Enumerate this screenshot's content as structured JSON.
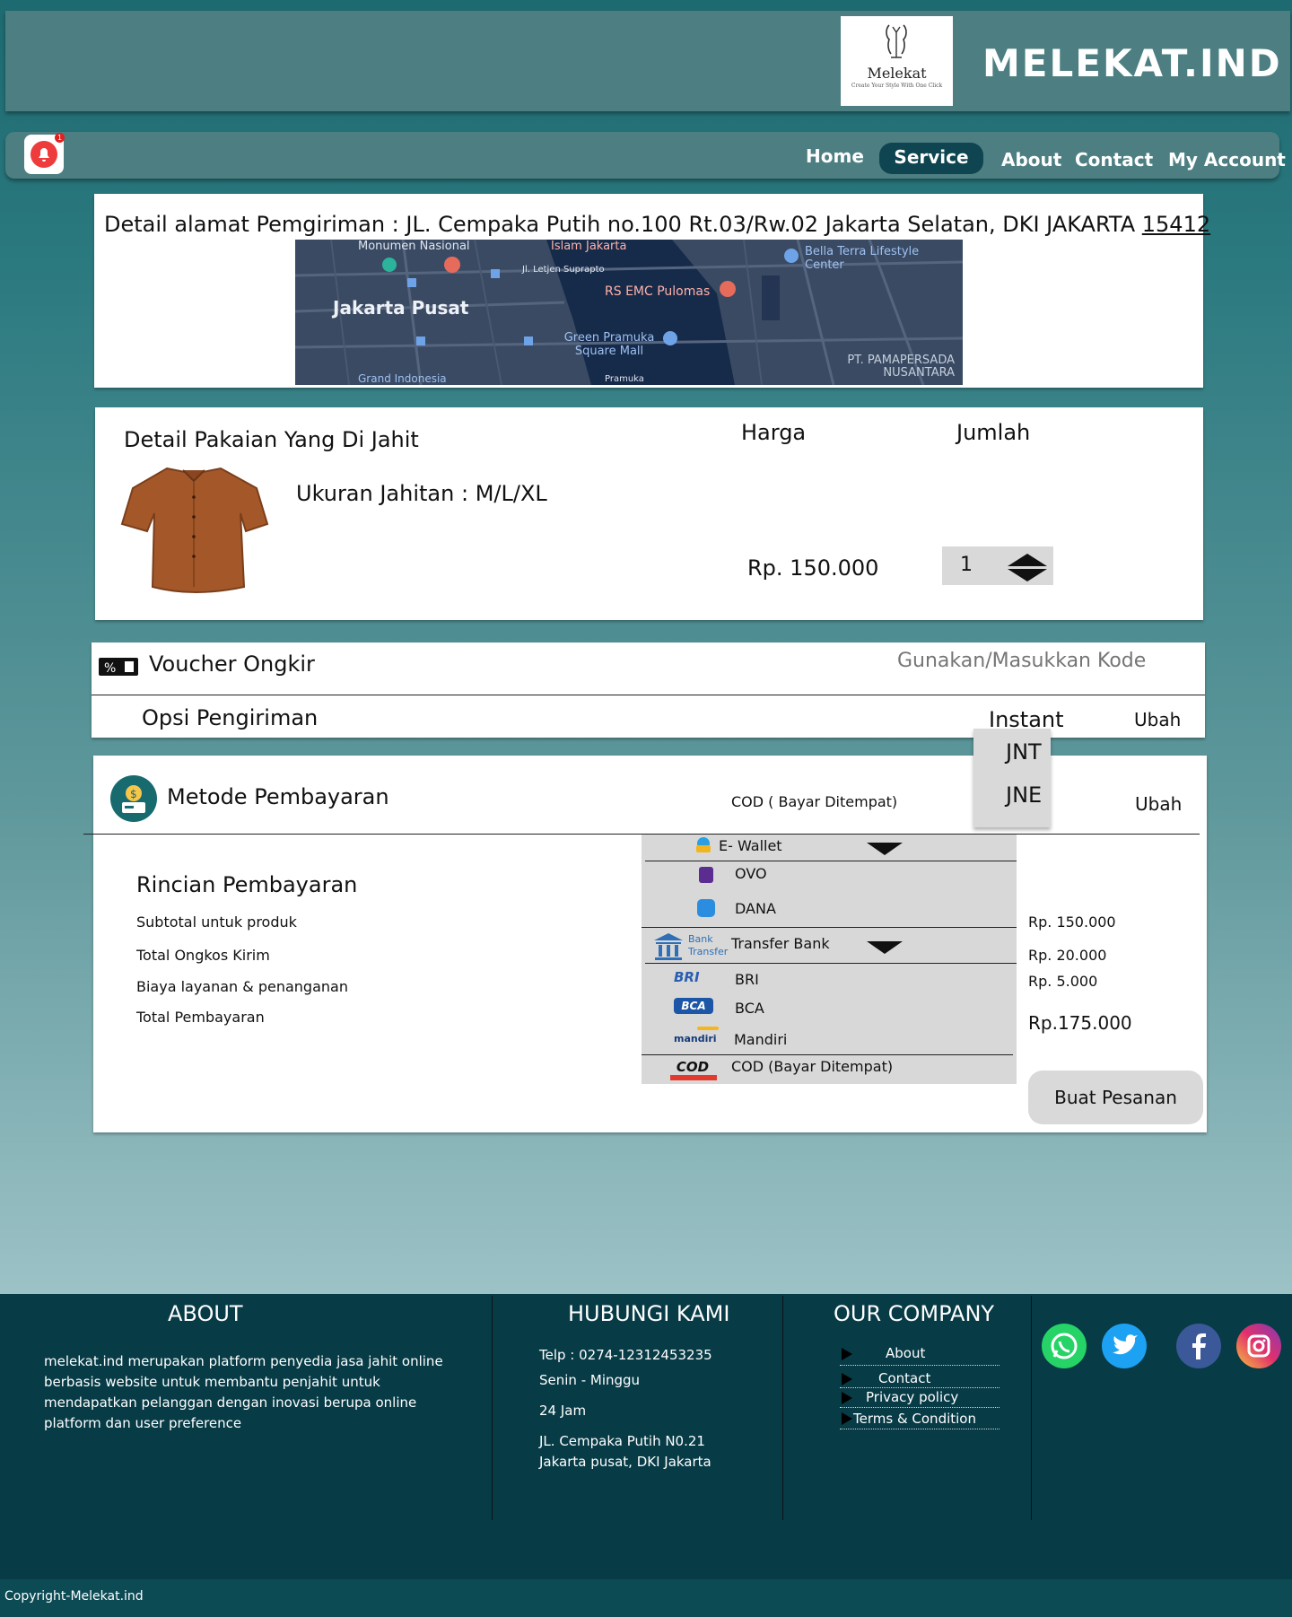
{
  "header": {
    "logo_title": "Melekat",
    "logo_subtitle": "Create Your Style With One Click",
    "brand": "MELEKAT.IND"
  },
  "nav": {
    "notification_count": "1",
    "items": [
      "Home",
      "Service",
      "About",
      "Contact",
      "My Account"
    ],
    "active": "Service"
  },
  "address": {
    "label": "Detail alamat Pemgiriman  :  JL. Cempaka Putih no.100 Rt.03/Rw.02 Jakarta  Selatan, DKI JAKARTA",
    "postal_code": "15412",
    "map_labels": [
      "Monumen Nasional",
      "Islam Jakarta",
      "Jl. Letjen Suprapto",
      "Bella Terra Lifestyle Center",
      "Jakarta Pusat",
      "RS EMC Pulomas",
      "Green Pramuka Square Mall",
      "PT. PAMAPERSADA NUSANTARA",
      "Grand Indonesia",
      "Pramuka"
    ]
  },
  "product": {
    "title": "Detail Pakaian Yang Di Jahit",
    "price_label": "Harga",
    "qty_label": "Jumlah",
    "size_text": "Ukuran Jahitan : M/L/XL",
    "price": "Rp. 150.000",
    "qty": "1"
  },
  "voucher": {
    "label": "Voucher Ongkir",
    "placeholder": "Gunakan/Masukkan Kode"
  },
  "shipping": {
    "label": "Opsi Pengiriman",
    "selected": "Instant",
    "change": "Ubah",
    "options": [
      "JNT",
      "JNE"
    ]
  },
  "payment": {
    "title": "Metode Pembayaran",
    "selected": "COD ( Bayar Ditempat)",
    "change": "Ubah",
    "ewallet_label": "E- Wallet",
    "ewallet_options": [
      "OVO",
      "DANA"
    ],
    "bank_icon_text": "Bank Transfer",
    "bank_label": "Transfer Bank",
    "bank_options": [
      "BRI",
      "BCA",
      "Mandiri"
    ],
    "bank_logos": [
      "BRI",
      "BCA",
      "mandiri"
    ],
    "cod_logo": "COD",
    "cod_label": "COD (Bayar Ditempat)"
  },
  "summary": {
    "title": "Rincian Pembayaran",
    "rows": [
      {
        "label": "Subtotal  untuk produk",
        "value": "Rp. 150.000"
      },
      {
        "label": "Total Ongkos Kirim",
        "value": "Rp. 20.000"
      },
      {
        "label": "Biaya layanan & penanganan",
        "value": "Rp. 5.000"
      },
      {
        "label": "Total Pembayaran",
        "value": "Rp.175.000"
      }
    ],
    "order_button": "Buat Pesanan"
  },
  "footer": {
    "about_title": "ABOUT",
    "about_text": "melekat.ind merupakan platform penyedia jasa jahit online berbasis website untuk membantu penjahit untuk mendapatkan pelanggan dengan inovasi berupa online platform dan user preference",
    "contact_title": "HUBUNGI KAMI",
    "phone": "Telp  :  0274-12312453235",
    "days": "Senin - Minggu",
    "hours": "24 Jam",
    "address_line1": "JL. Cempaka Putih N0.21",
    "address_line2": "Jakarta pusat, DKI Jakarta",
    "company_title": "OUR COMPANY",
    "company_links": [
      "About",
      "Contact",
      "Privacy policy",
      "Terms & Condition"
    ],
    "copyright": "Copyright-Melekat.ind"
  },
  "colors": {
    "header_bg": "#4d7f82",
    "nav_active": "#0e4550",
    "footer_bg": "#073b46",
    "whatsapp": "#25d366",
    "twitter": "#1da1f2",
    "facebook": "#3b5998"
  }
}
